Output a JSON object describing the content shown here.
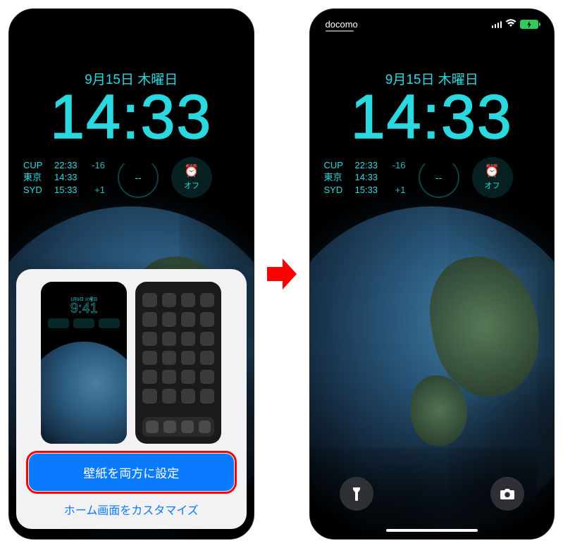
{
  "carrier": "docomo",
  "date_line": "9月15日 木曜日",
  "time": "14:33",
  "world_clocks": [
    {
      "city": "CUP",
      "time": "22:33",
      "offset": "-16"
    },
    {
      "city": "東京",
      "time": "14:33",
      "offset": ""
    },
    {
      "city": "SYD",
      "time": "15:33",
      "offset": "+1"
    }
  ],
  "gauge_value": "--",
  "alarm_label": "オフ",
  "preview": {
    "date": "1月9日 火曜日",
    "time": "9:41"
  },
  "sheet": {
    "primary": "壁紙を両方に設定",
    "secondary": "ホーム画面をカスタマイズ"
  }
}
